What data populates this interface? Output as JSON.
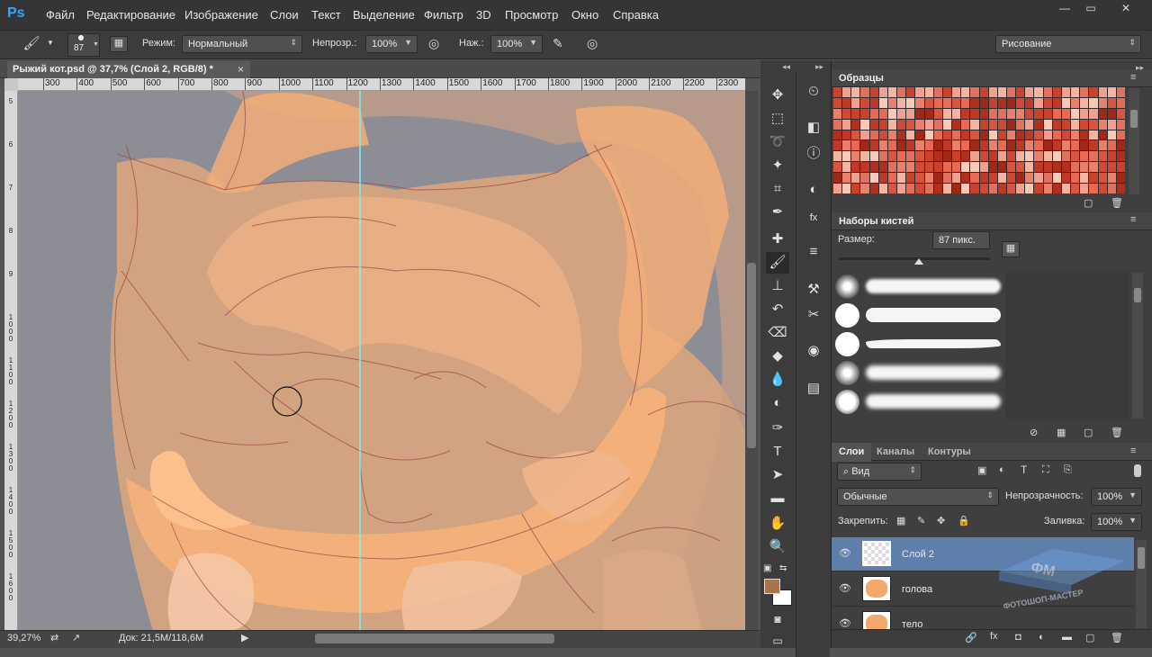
{
  "app": {
    "logo": "Ps",
    "window_controls": [
      "—",
      "▭",
      "✕"
    ]
  },
  "menu": [
    "Файл",
    "Редактирование",
    "Изображение",
    "Слои",
    "Текст",
    "Выделение",
    "Фильтр",
    "3D",
    "Просмотр",
    "Окно",
    "Справка"
  ],
  "options": {
    "brush_size": "87",
    "mode_label": "Режим:",
    "mode_value": "Нормальный",
    "opacity_label": "Непрозр.:",
    "opacity_value": "100%",
    "flow_label": "Наж.:",
    "flow_value": "100%",
    "workspace": "Рисование"
  },
  "document": {
    "tab_title": "Рыжий кот.psd @ 37,7% (Слой 2, RGB/8) *",
    "close": "×"
  },
  "ruler_h": [
    "300",
    "400",
    "500",
    "600",
    "700",
    "800",
    "900",
    "1000",
    "1100",
    "1200",
    "1300",
    "1400",
    "1500",
    "1600",
    "1700",
    "1800",
    "1900",
    "2000",
    "2100",
    "2200",
    "2300"
  ],
  "ruler_v": [
    "5",
    "6",
    "7",
    "8",
    "9",
    "1000",
    "1100",
    "1200",
    "1300",
    "1400",
    "1500",
    "1600"
  ],
  "status": {
    "zoom": "39,27%",
    "doc": "Док: 21,5M/118,6M"
  },
  "swatches_panel": {
    "title": "Образцы",
    "colors": [
      "#c8422c",
      "#d85540",
      "#e8806c",
      "#f0a090",
      "#b03020",
      "#e86a54",
      "#f4b4a4",
      "#d04838",
      "#a02818",
      "#e07060",
      "#f8c8b8",
      "#c03828"
    ]
  },
  "brushes_panel": {
    "title": "Наборы кистей",
    "size_label": "Размер:",
    "size_value": "87 пикс.",
    "size_level": 0.53
  },
  "layers_panel": {
    "tabs": [
      "Слои",
      "Каналы",
      "Контуры"
    ],
    "filter_kind": "Вид",
    "blend_mode": "Обычные",
    "opacity_label": "Непрозрачность:",
    "opacity_value": "100%",
    "lock_label": "Закрепить:",
    "fill_label": "Заливка:",
    "fill_value": "100%",
    "layers": [
      {
        "name": "Слой 2",
        "selected": true
      },
      {
        "name": "голова",
        "selected": false
      },
      {
        "name": "тело",
        "selected": false
      }
    ],
    "watermark": "ФОТОШОП-МАСТЕР"
  },
  "colors": {
    "accent": "#31a8ff",
    "fur": "#f2ae78",
    "selected_layer": "#5f7fab",
    "guide": "#7ff0f0"
  }
}
